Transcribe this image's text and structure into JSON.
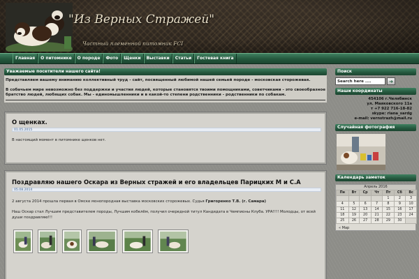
{
  "header": {
    "title": "\"Из Верных Стражей\"",
    "subtitle": "Частный племенной питомник FCI"
  },
  "nav": {
    "items": [
      "Главная",
      "О питомнике",
      "О породе",
      "Фото",
      "Щенки",
      "Выставки",
      "Статьи",
      "Гостевая книга"
    ]
  },
  "welcome": {
    "heading": "Уважаемые посетители нашего сайта!",
    "p1": "Представляем вашему вниманию коллективный труд - сайт, посвященный любимой нашей семьей породе - московская сторожевая.",
    "p2": "В собачьем мире невозможно без поддержки и участия людей, которые становятся твоими помощниками, советчиками - это своеобразное братство людей, любящих собак. Мы - единомышленники и в какой-то степени родственники - родственники по собакам."
  },
  "posts": [
    {
      "title": "О щенках.",
      "date": "01.05.2015",
      "text": "В настоящий момент в питомнике щенков нет."
    },
    {
      "title": "Поздравляю нашего Оскара из Верных стражей и его владельцев Парицких М и С.А",
      "date": "05.08.2014",
      "text1_pre": "2 августа 2014 прошла первая в Омске монопородная выставка московских сторожевых. Судья",
      "text1_judge": "Григоренко Т.В. (г. Самара)",
      "text2": "Наш Оскар стал Лучшим представителем породы, Лучшим кобелём, получил очередной титул Кандидата в Чемпионы Клуба. УРА!!!! Молодцы, от всей души поздравляю!!!"
    }
  ],
  "sidebar": {
    "search_heading": "Поиск",
    "search_value": "Search here ....",
    "search_icon": "arrow-right-icon",
    "contacts_heading": "Наши координаты",
    "contacts_lines": [
      "454106 г.Челябинск",
      "ул. Маяковского 11а",
      "т +7 922 716-18-82",
      "skype: riana_sardg",
      "e-mail: vernstrazh@mail.ru"
    ],
    "photo_heading": "Случайная фотография",
    "calendar_heading": "Календарь заметок",
    "calendar_month": "Апрель 2016",
    "calendar_days": [
      "Пн",
      "Вт",
      "Ср",
      "Чт",
      "Пт",
      "Сб",
      "Вс"
    ],
    "calendar_rows": [
      [
        "",
        "",
        "",
        "",
        "1",
        "2",
        "3"
      ],
      [
        "4",
        "5",
        "6",
        "7",
        "8",
        "9",
        "10"
      ],
      [
        "11",
        "12",
        "13",
        "14",
        "15",
        "16",
        "17"
      ],
      [
        "18",
        "19",
        "20",
        "21",
        "22",
        "23",
        "24"
      ],
      [
        "25",
        "26",
        "27",
        "28",
        "29",
        "30",
        ""
      ]
    ],
    "calendar_prev": "« Мар"
  },
  "colors": {
    "nav_green": "#24573d",
    "header_brown": "#2c2620",
    "content_gray": "#8d8d88"
  }
}
